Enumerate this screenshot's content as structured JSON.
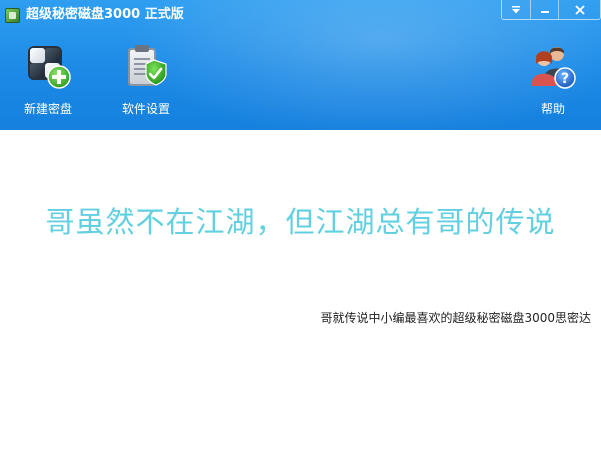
{
  "window": {
    "title": "超级秘密磁盘3000 正式版",
    "controls": {
      "menu_icon": "dropdown-arrow-icon",
      "minimize_icon": "minimize-icon",
      "close_icon": "close-icon"
    }
  },
  "toolbar": {
    "new_disk": {
      "label": "新建密盘",
      "icon": "new-disk-icon"
    },
    "settings": {
      "label": "软件设置",
      "icon": "settings-clipboard-icon"
    },
    "help": {
      "label": "帮助",
      "icon": "help-users-icon"
    }
  },
  "content": {
    "slogan": "哥虽然不在江湖，但江湖总有哥的传说",
    "subtext": "哥就传说中小编最喜欢的超级秘密磁盘3000思密达"
  },
  "colors": {
    "header_blue": "#1c8ae6",
    "slogan_cyan": "#62d0e0",
    "background": "#ffffff"
  }
}
